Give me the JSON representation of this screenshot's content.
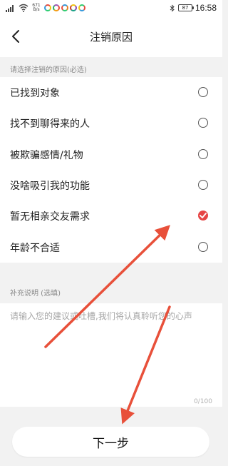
{
  "status_bar": {
    "network_speed": "671\nB/s",
    "time": "16:58",
    "battery": "87"
  },
  "header": {
    "title": "注销原因"
  },
  "reasons": {
    "section_label": "请选择注销的原因(必选)",
    "items": [
      {
        "label": "已找到对象",
        "selected": false
      },
      {
        "label": "找不到聊得来的人",
        "selected": false
      },
      {
        "label": "被欺骗感情/礼物",
        "selected": false
      },
      {
        "label": "没啥吸引我的功能",
        "selected": false
      },
      {
        "label": "暂无相亲交友需求",
        "selected": true
      },
      {
        "label": "年龄不合适",
        "selected": false
      }
    ]
  },
  "supplement": {
    "section_label": "补充说明 (选填)",
    "placeholder": "请输入您的建议或吐槽,我们将认真聆听您的心声",
    "value": "",
    "counter": "0/100"
  },
  "next_button": {
    "label": "下一步"
  },
  "colors": {
    "accent": "#e64545",
    "annotation_arrow": "#e8503a",
    "background": "#f2f2f2"
  },
  "icons": {
    "back": "chevron-left-icon",
    "selected": "checkmark-icon",
    "signal": "signal-icon",
    "wifi": "wifi-icon",
    "bluetooth": "bluetooth-icon",
    "battery": "battery-icon"
  }
}
